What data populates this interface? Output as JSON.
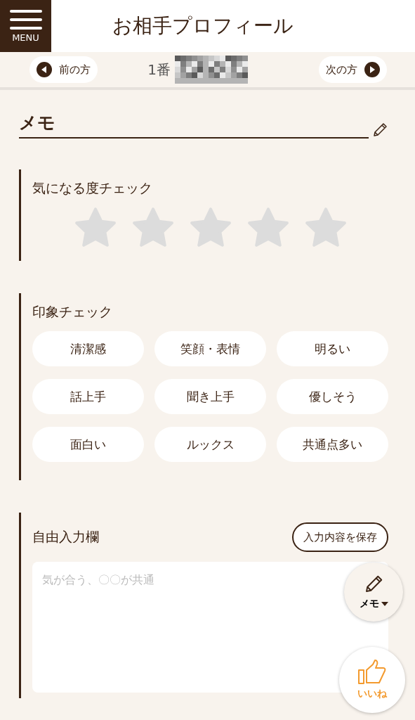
{
  "header": {
    "menu_label": "MENU",
    "title": "お相手プロフィール"
  },
  "nav": {
    "prev": "前の方",
    "number": "1番",
    "next": "次の方"
  },
  "memo": {
    "title": "メモ"
  },
  "rating": {
    "title": "気になる度チェック",
    "stars": 0
  },
  "impressions": {
    "title": "印象チェック",
    "tags": [
      {
        "label": "清潔感",
        "selected": false
      },
      {
        "label": "笑顔・表情",
        "selected": false
      },
      {
        "label": "明るい",
        "selected": false
      },
      {
        "label": "話上手",
        "selected": false
      },
      {
        "label": "聞き上手",
        "selected": false
      },
      {
        "label": "優しそう",
        "selected": false
      },
      {
        "label": "面白い",
        "selected": false
      },
      {
        "label": "ルックス",
        "selected": false
      },
      {
        "label": "共通点多い",
        "selected": false
      }
    ]
  },
  "free_input": {
    "title": "自由入力欄",
    "save_button": "入力内容を保存",
    "placeholder": "気が合う、〇〇が共通"
  },
  "fab": {
    "memo": "メモ",
    "like": "いいね"
  }
}
